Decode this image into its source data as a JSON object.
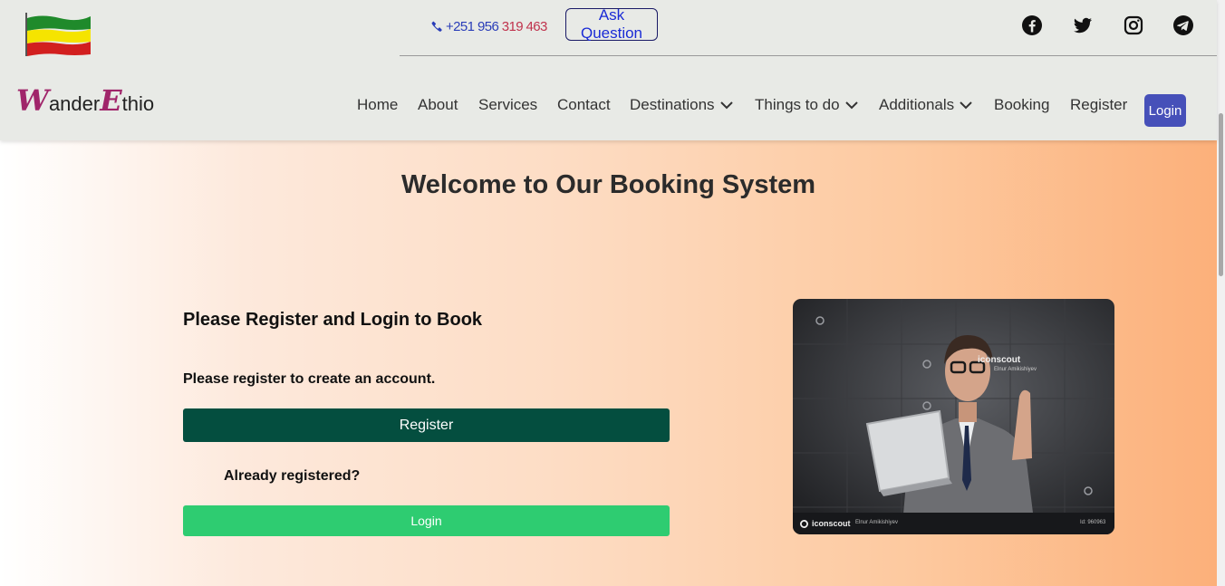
{
  "header": {
    "phone": {
      "icon": "phone-icon",
      "number_main": "+251 956",
      "number_tail": "319 463"
    },
    "ask_button": "Ask Question",
    "social": [
      "facebook-icon",
      "twitter-icon",
      "instagram-icon",
      "telegram-icon"
    ]
  },
  "brand": {
    "w_letter": "W",
    "ander": "ander",
    "e_letter": "E",
    "thio": "thio"
  },
  "nav": {
    "items": [
      {
        "label": "Home"
      },
      {
        "label": "About"
      },
      {
        "label": "Services"
      },
      {
        "label": "Contact"
      },
      {
        "label": "Destinations",
        "dropdown": true
      },
      {
        "label": "Things to do",
        "dropdown": true
      },
      {
        "label": "Additionals",
        "dropdown": true
      },
      {
        "label": "Booking"
      },
      {
        "label": "Register"
      }
    ],
    "login": "Login"
  },
  "main": {
    "welcome": "Welcome to Our Booking System",
    "card_title": "Please Register and Login to Book",
    "register_text": "Please register to create an account.",
    "register_button": "Register",
    "already": "Already registered?",
    "login_button": "Login"
  },
  "photo": {
    "watermark": "iconscout",
    "watermark_author": "Elnur Amikishiyev",
    "footer_brand": "iconscout",
    "footer_author": "Elnur Amikishiyev",
    "footer_id": "Id: 960963"
  },
  "colors": {
    "header_bg": "#e8eae6",
    "login_nav_bg": "#4650b9",
    "register_bg": "#044e3f",
    "login_bg": "#2ecc71",
    "brand_accent": "#a0256a"
  }
}
